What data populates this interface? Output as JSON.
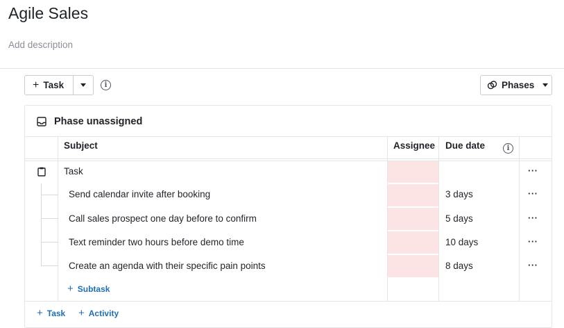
{
  "page": {
    "title": "Agile Sales",
    "description_placeholder": "Add description"
  },
  "toolbar": {
    "task_label": "Task",
    "phases_label": "Phases"
  },
  "phase": {
    "title": "Phase unassigned"
  },
  "table": {
    "columns": {
      "subject": "Subject",
      "assignee": "Assignee",
      "due_date": "Due date"
    },
    "parent": {
      "subject": "Task",
      "due": ""
    },
    "subtasks": [
      {
        "subject": "Send calendar invite after booking",
        "due": "3 days"
      },
      {
        "subject": "Call sales prospect one day before to confirm",
        "due": "5 days"
      },
      {
        "subject": "Text reminder two hours before demo time",
        "due": "10 days"
      },
      {
        "subject": "Create an agenda with their specific pain points",
        "due": "8 days"
      }
    ],
    "add_subtask_label": "Subtask",
    "more_label": "···"
  },
  "footer": {
    "add_task_label": "Task",
    "add_activity_label": "Activity"
  },
  "colors": {
    "assignee_required_bg": "#fde4e4",
    "link": "#1f6fb5",
    "border": "#e3e5e8"
  }
}
